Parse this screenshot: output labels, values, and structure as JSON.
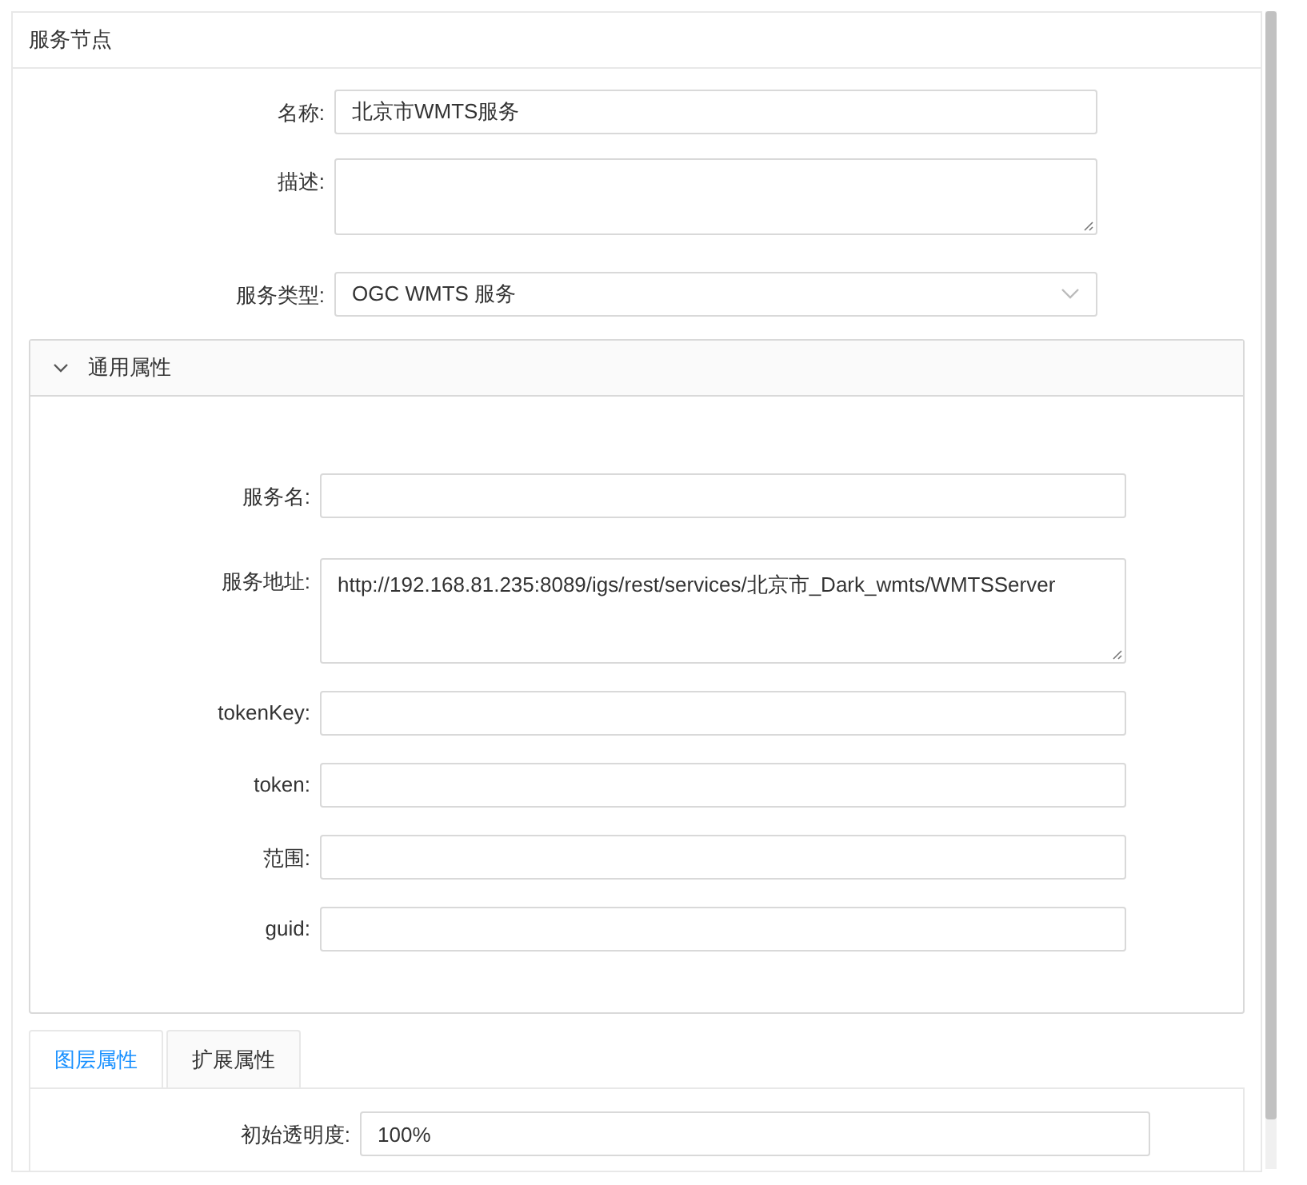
{
  "panel": {
    "title": "服务节点"
  },
  "fields": [
    {
      "label": "名称:",
      "kind": "input",
      "value": "北京市WMTS服务"
    },
    {
      "label": "描述:",
      "kind": "textarea"
    },
    {
      "label": "服务类型:",
      "kind": "select",
      "value": "OGC WMTS 服务"
    }
  ],
  "general": {
    "title": "通用属性",
    "expanded": true,
    "fields": [
      {
        "label": "服务名:",
        "kind": "input"
      },
      {
        "label": "服务地址:",
        "kind": "textarea",
        "value": "http://192.168.81.235:8089/igs/rest/services/北京市_Dark_wmts/WMTSServer"
      },
      {
        "label": "tokenKey:",
        "kind": "input"
      },
      {
        "label": "token:",
        "kind": "input"
      },
      {
        "label": "范围:",
        "kind": "input"
      },
      {
        "label": "guid:",
        "kind": "input"
      }
    ]
  },
  "tabs": [
    {
      "label": "图层属性",
      "selected": true
    },
    {
      "label": "扩展属性",
      "selected": false
    }
  ],
  "layer_fields": [
    {
      "label": "初始透明度:",
      "kind": "input",
      "value": "100%"
    }
  ]
}
